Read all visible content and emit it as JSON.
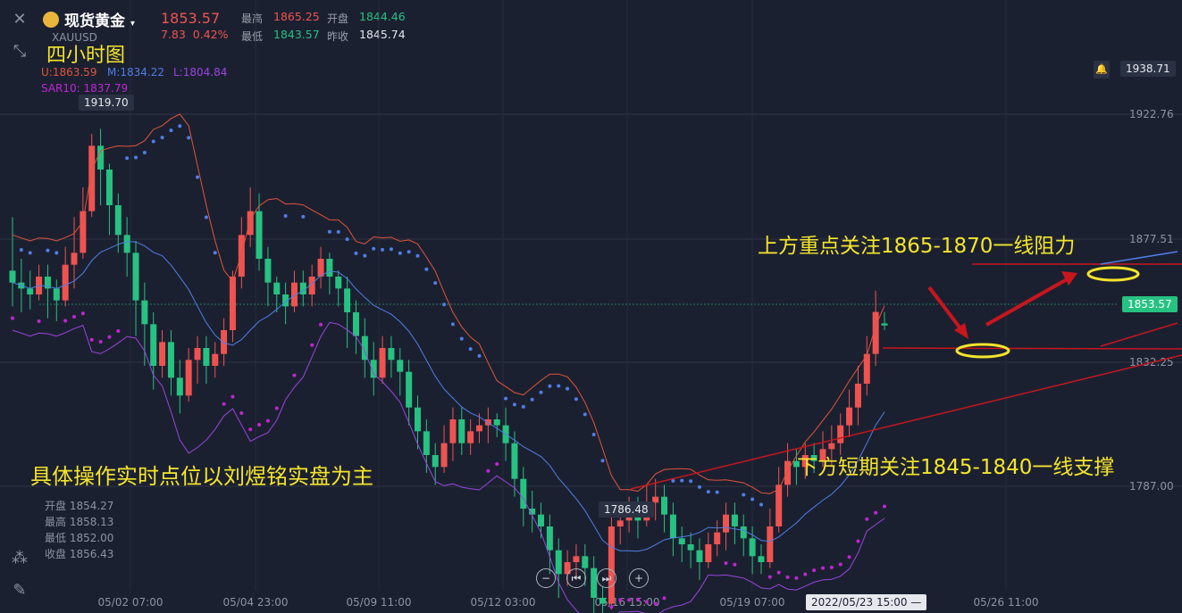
{
  "header": {
    "name": "现货黄金",
    "symbol": "XAUUSD",
    "price": "1853.57",
    "change": "7.83",
    "change_pct": "0.42%",
    "high_label": "最高",
    "high": "1865.25",
    "low_label": "最低",
    "low": "1843.57",
    "open_label": "开盘",
    "open": "1844.46",
    "prev_label": "昨收",
    "prev": "1845.74"
  },
  "overlay": {
    "timeframe": "四小时图",
    "bb_upper": "U:1863.59",
    "bb_mid": "M:1834.22",
    "bb_lower": "L:1804.84",
    "sar": "SAR10: 1837.79",
    "annot_resistance": "上方重点关注1865-1870一线阻力",
    "annot_support": "下方短期关注1845-1840一线支撑",
    "annot_note": "具体操作实时点位以刘煜铭实盘为主"
  },
  "ohlc_box": {
    "open": "开盘 1854.27",
    "high": "最高 1858.13",
    "low": "最低 1852.00",
    "close": "收盘 1856.43"
  },
  "price_tags": {
    "top_right": "1938.71",
    "current": "1853.57",
    "max_marker": "1919.70",
    "min_marker": "1786.48",
    "crosshair_time": "2022/05/23 15:00"
  },
  "colors": {
    "up": "#ef5350",
    "down": "#26c281",
    "bb_upper": "#e2543a",
    "bb_mid": "#4f7ee8",
    "bb_lower": "#9a45e0",
    "sar_blue": "#4f7ee8",
    "sar_magenta": "#c026d3",
    "annotation": "#f5e52a",
    "drawn_line": "#c8161d"
  },
  "chart_data": {
    "type": "candlestick",
    "y_ticks": [
      "1922.76",
      "1877.51",
      "1832.25",
      "1787.00"
    ],
    "x_ticks": [
      "05/02 07:00",
      "05/04 23:00",
      "05/09 11:00",
      "05/12 03:00",
      "05/16 15:00",
      "05/19 07:00",
      "05/26 11:00"
    ],
    "ylim": [
      1765,
      1945
    ],
    "candles": [
      [
        1872,
        1868,
        1860,
        1890
      ],
      [
        1868,
        1866,
        1858,
        1876
      ],
      [
        1866,
        1864,
        1859,
        1872
      ],
      [
        1864,
        1870,
        1862,
        1874
      ],
      [
        1870,
        1866,
        1856,
        1874
      ],
      [
        1866,
        1862,
        1855,
        1869
      ],
      [
        1862,
        1874,
        1860,
        1880
      ],
      [
        1874,
        1878,
        1866,
        1890
      ],
      [
        1878,
        1892,
        1876,
        1900
      ],
      [
        1892,
        1914,
        1890,
        1918
      ],
      [
        1914,
        1906,
        1894,
        1919.7
      ],
      [
        1906,
        1894,
        1884,
        1908
      ],
      [
        1894,
        1884,
        1878,
        1898
      ],
      [
        1884,
        1878,
        1870,
        1890
      ],
      [
        1878,
        1862,
        1850,
        1882
      ],
      [
        1862,
        1854,
        1840,
        1868
      ],
      [
        1854,
        1840,
        1832,
        1858
      ],
      [
        1840,
        1848,
        1836,
        1852
      ],
      [
        1848,
        1836,
        1830,
        1852
      ],
      [
        1836,
        1830,
        1824,
        1842
      ],
      [
        1830,
        1842,
        1828,
        1846
      ],
      [
        1842,
        1846,
        1834,
        1850
      ],
      [
        1846,
        1840,
        1834,
        1850
      ],
      [
        1840,
        1844,
        1836,
        1848
      ],
      [
        1844,
        1852,
        1840,
        1856
      ],
      [
        1852,
        1870,
        1848,
        1872
      ],
      [
        1870,
        1884,
        1866,
        1890
      ],
      [
        1884,
        1892,
        1880,
        1900
      ],
      [
        1892,
        1876,
        1872,
        1898
      ],
      [
        1876,
        1868,
        1860,
        1880
      ],
      [
        1868,
        1864,
        1858,
        1870
      ],
      [
        1864,
        1860,
        1854,
        1868
      ],
      [
        1860,
        1868,
        1858,
        1872
      ],
      [
        1868,
        1864,
        1860,
        1872
      ],
      [
        1864,
        1870,
        1860,
        1874
      ],
      [
        1870,
        1876,
        1866,
        1880
      ],
      [
        1876,
        1870,
        1864,
        1878
      ],
      [
        1870,
        1866,
        1860,
        1872
      ],
      [
        1866,
        1858,
        1846,
        1870
      ],
      [
        1858,
        1850,
        1844,
        1862
      ],
      [
        1850,
        1842,
        1836,
        1856
      ],
      [
        1842,
        1836,
        1830,
        1848
      ],
      [
        1836,
        1846,
        1834,
        1850
      ],
      [
        1846,
        1842,
        1836,
        1850
      ],
      [
        1842,
        1838,
        1830,
        1846
      ],
      [
        1838,
        1826,
        1820,
        1842
      ],
      [
        1826,
        1818,
        1812,
        1830
      ],
      [
        1818,
        1810,
        1804,
        1822
      ],
      [
        1810,
        1806,
        1800,
        1814
      ],
      [
        1806,
        1814,
        1804,
        1820
      ],
      [
        1814,
        1822,
        1808,
        1826
      ],
      [
        1822,
        1814,
        1810,
        1826
      ],
      [
        1814,
        1818,
        1810,
        1822
      ],
      [
        1818,
        1820,
        1814,
        1824
      ],
      [
        1820,
        1822,
        1814,
        1826
      ],
      [
        1822,
        1820,
        1816,
        1824
      ],
      [
        1820,
        1814,
        1808,
        1826
      ],
      [
        1814,
        1802,
        1796,
        1818
      ],
      [
        1802,
        1792,
        1786,
        1806
      ],
      [
        1792,
        1790,
        1784,
        1798
      ],
      [
        1790,
        1786,
        1782,
        1794
      ],
      [
        1786,
        1778,
        1770,
        1790
      ],
      [
        1778,
        1770,
        1762,
        1782
      ],
      [
        1770,
        1774,
        1766,
        1778
      ],
      [
        1774,
        1776,
        1768,
        1780
      ],
      [
        1776,
        1772,
        1766,
        1780
      ],
      [
        1772,
        1762,
        1756,
        1776
      ],
      [
        1762,
        1760,
        1754,
        1766
      ],
      [
        1760,
        1786,
        1758,
        1790
      ],
      [
        1786,
        1788,
        1780,
        1794
      ],
      [
        1788,
        1792,
        1784,
        1796
      ],
      [
        1792,
        1788,
        1782,
        1796
      ],
      [
        1788,
        1794,
        1786,
        1800
      ],
      [
        1794,
        1796,
        1788,
        1802
      ],
      [
        1796,
        1790,
        1784,
        1800
      ],
      [
        1790,
        1782,
        1776,
        1794
      ],
      [
        1782,
        1780,
        1774,
        1786
      ],
      [
        1780,
        1778,
        1772,
        1784
      ],
      [
        1778,
        1774,
        1768,
        1782
      ],
      [
        1774,
        1780,
        1772,
        1784
      ],
      [
        1780,
        1784,
        1776,
        1788
      ],
      [
        1784,
        1790,
        1778,
        1794
      ],
      [
        1790,
        1786,
        1780,
        1794
      ],
      [
        1786,
        1782,
        1776,
        1790
      ],
      [
        1782,
        1776,
        1770,
        1786
      ],
      [
        1776,
        1774,
        1770,
        1780
      ],
      [
        1774,
        1786,
        1772,
        1792
      ],
      [
        1786,
        1800,
        1784,
        1806
      ],
      [
        1800,
        1808,
        1796,
        1814
      ],
      [
        1808,
        1806,
        1800,
        1812
      ],
      [
        1806,
        1810,
        1802,
        1814
      ],
      [
        1810,
        1808,
        1804,
        1814
      ],
      [
        1808,
        1812,
        1806,
        1818
      ],
      [
        1812,
        1814,
        1806,
        1820
      ],
      [
        1814,
        1820,
        1810,
        1824
      ],
      [
        1820,
        1826,
        1816,
        1832
      ],
      [
        1826,
        1834,
        1820,
        1840
      ],
      [
        1834,
        1844,
        1830,
        1850
      ],
      [
        1844,
        1858.13,
        1840,
        1865.25
      ],
      [
        1854.27,
        1853.57,
        1852,
        1858.13
      ]
    ]
  }
}
